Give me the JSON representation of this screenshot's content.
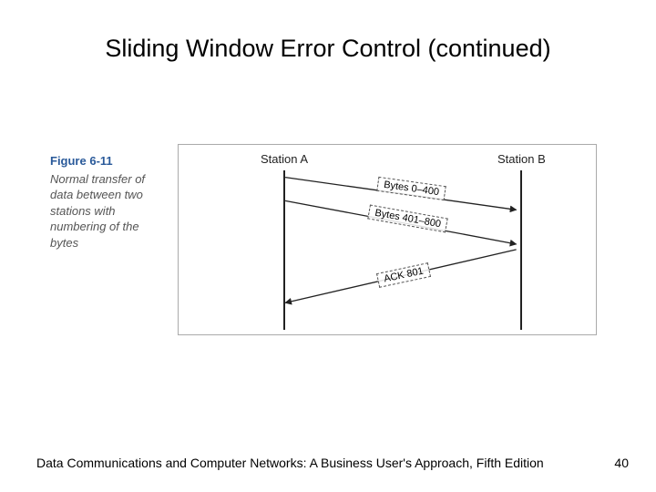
{
  "title": "Sliding Window Error Control (continued)",
  "figure": {
    "label": "Figure 6-11",
    "description": "Normal transfer of data between two stations with numbering of the bytes",
    "station_a": "Station A",
    "station_b": "Station B",
    "msg1": "Bytes 0–400",
    "msg2": "Bytes 401–800",
    "msg3": "ACK 801"
  },
  "footer": "Data Communications and Computer Networks: A Business User's Approach, Fifth Edition",
  "page": "40"
}
